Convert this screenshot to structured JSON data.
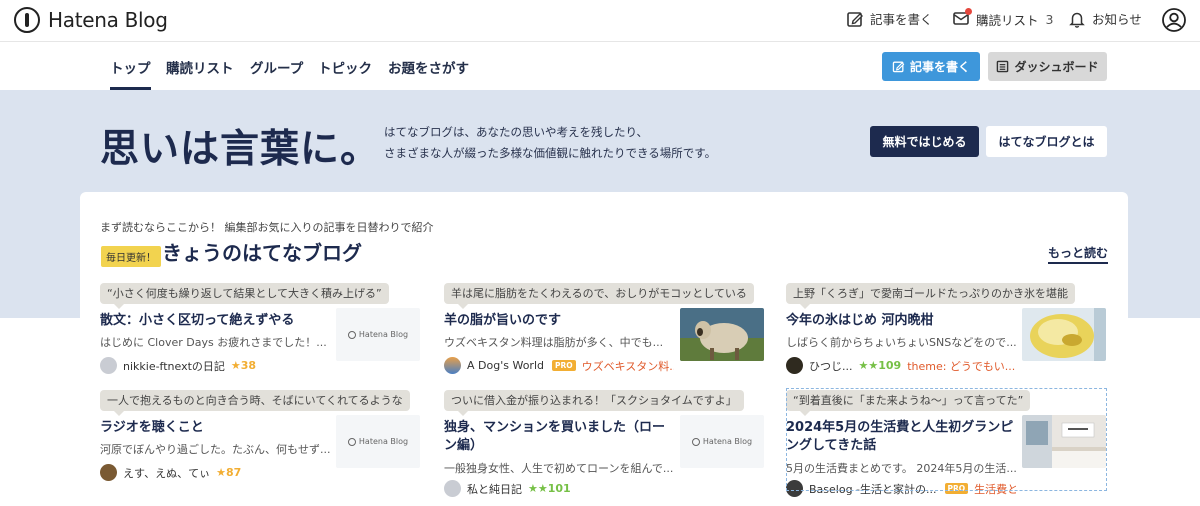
{
  "header": {
    "logo": "Hatena Blog",
    "write": "記事を書く",
    "reading_list": "購読リスト",
    "reading_count": "3",
    "notifications": "お知らせ"
  },
  "nav": {
    "tabs": [
      "トップ",
      "購読リスト",
      "グループ",
      "トピック",
      "お題をさがす"
    ],
    "write_button": "記事を書く",
    "dashboard_button": "ダッシュボード"
  },
  "hero": {
    "title": "思いは言葉に。",
    "desc_line1": "はてなブログは、あなたの思いや考えを残したり、",
    "desc_line2": "さまざまな人が綴った多様な価値観に触れたりできる場所です。",
    "start_button": "無料ではじめる",
    "about_button": "はてなブログとは"
  },
  "section": {
    "intro": "まず読むならここから！ 編集部お気に入りの記事を日替わりで紹介",
    "badge": "毎日更新！",
    "title": "きょうのはてなブログ",
    "more": "もっと読む"
  },
  "placeholder_label": "Hatena Blog",
  "entries": [
    {
      "quote": "“小さく何度も繰り返して結果として大きく積み上げる”",
      "title": "散文：小さく区切って絶えずやる",
      "excerpt": "はじめに Clover Days お疲れさまでした！...",
      "blog": "nikkie-ftnextの日記",
      "stars": "★38",
      "pro": "",
      "category": ""
    },
    {
      "quote": "羊は尾に脂肪をたくわえるので、おしりがモコッとしている",
      "title": "羊の脂が旨いのです",
      "excerpt": "ウズベキスタン料理は脂肪が多く、中でも...",
      "blog": "A Dog's World",
      "stars": "",
      "pro": "PRO",
      "category": "ウズベキスタン料..."
    },
    {
      "quote": "上野「くろぎ」で愛南ゴールドたっぷりのかき氷を堪能",
      "title": "今年の氷はじめ 河内晩柑",
      "excerpt": "しばらく前からちょいちょいSNSなどをので...",
      "blog": "ひつじ...",
      "stars": "★★109",
      "pro": "",
      "category": "theme: どうでもい..."
    },
    {
      "quote": "一人で抱えるものと向き合う時、そばにいてくれてるような",
      "title": "ラジオを聴くこと",
      "excerpt": "河原でぼんやり過ごした。たぶん、何もせず...",
      "blog": "えす、えぬ、てぃ",
      "stars": "★87",
      "pro": "",
      "category": ""
    },
    {
      "quote": "ついに借入金が振り込まれる！「スクショタイムですよ」",
      "title": "独身、マンションを買いました（ローン編）",
      "excerpt": "一般独身女性、人生で初めてローンを組んで...",
      "blog": "私と純日記",
      "stars": "★★101",
      "pro": "",
      "category": ""
    },
    {
      "quote": "“到着直後に「また来ようね〜」って言ってた”",
      "title": "2024年5月の生活費と人生初グランピングしてきた話",
      "excerpt": "5月の生活費まとめです。 2024年5月の生活...",
      "blog": "Baselog -生活と家計の...",
      "stars": "",
      "pro": "PRO",
      "category": "生活費と..."
    }
  ]
}
